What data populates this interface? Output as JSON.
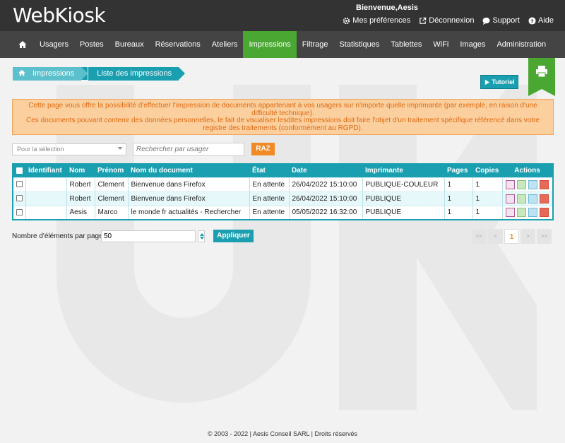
{
  "header": {
    "logo": "WebKiosk",
    "welcome": "Bienvenue,Aesis",
    "links": [
      {
        "label": "Mes préférences",
        "icon": "gear-icon"
      },
      {
        "label": "Déconnexion",
        "icon": "logout-icon"
      },
      {
        "label": "Support",
        "icon": "chat-icon"
      },
      {
        "label": "Aide",
        "icon": "help-icon"
      }
    ]
  },
  "nav": {
    "items": [
      "Usagers",
      "Postes",
      "Bureaux",
      "Réservations",
      "Ateliers",
      "Impressions",
      "Filtrage",
      "Statistiques",
      "Tablettes",
      "WiFi",
      "Images",
      "Administration"
    ],
    "active": "Impressions"
  },
  "breadcrumb": [
    "Impressions",
    "Liste des impressions"
  ],
  "tutorial_label": "Tutoriel",
  "notice": {
    "line1": "Cette page vous offre la possibilité d'effectuer l'impression de documents appartenant à vos usagers sur n'importe quelle imprimante (par exemple, en raison d'une difficulté technique).",
    "line2": "Ces documents pouvant contenir des données personnelles, le fait de visualiser lesdites impressions doit faire l'objet d'un traitement spécifique référencé dans votre registre des traitements (conformément au RGPD)."
  },
  "filters": {
    "selection_placeholder": "Pour la sélection",
    "search_placeholder": "Rechercher par usager",
    "reset_label": "RAZ"
  },
  "table": {
    "columns": [
      "Identifiant",
      "Nom",
      "Prénom",
      "Nom du document",
      "État",
      "Date",
      "Imprimante",
      "Pages",
      "Copies",
      "Actions"
    ],
    "rows": [
      {
        "id": "",
        "nom": "Robert",
        "prenom": "Clement",
        "document": "Bienvenue dans Firefox",
        "etat": "En attente",
        "date": "26/04/2022 15:10:00",
        "imprimante": "PUBLIQUE-COULEUR",
        "pages": "1",
        "copies": "1"
      },
      {
        "id": "",
        "nom": "Robert",
        "prenom": "Clement",
        "document": "Bienvenue dans Firefox",
        "etat": "En attente",
        "date": "26/04/2022 15:10:00",
        "imprimante": "PUBLIQUE",
        "pages": "1",
        "copies": "1"
      },
      {
        "id": "",
        "nom": "Aesis",
        "prenom": "Marco",
        "document": "le monde fr actualités - Rechercher",
        "etat": "En attente",
        "date": "05/05/2022 16:32:00",
        "imprimante": "PUBLIQUE",
        "pages": "1",
        "copies": "1"
      }
    ]
  },
  "pagination": {
    "per_page_label": "Nombre d'éléments par page",
    "per_page_value": "50",
    "apply_label": "Appliquer",
    "buttons": [
      "<<",
      "<",
      "1",
      ">",
      ">>"
    ],
    "current": "1"
  },
  "footer": "© 2003 - 2022 | Aesis Conseil SARL | Droits réservés",
  "colors": {
    "accent": "#1a9fb0",
    "active_nav": "#4aa832",
    "warning_bg": "#fbcf9e",
    "warning_text": "#e06b12",
    "raz": "#f08a24"
  }
}
